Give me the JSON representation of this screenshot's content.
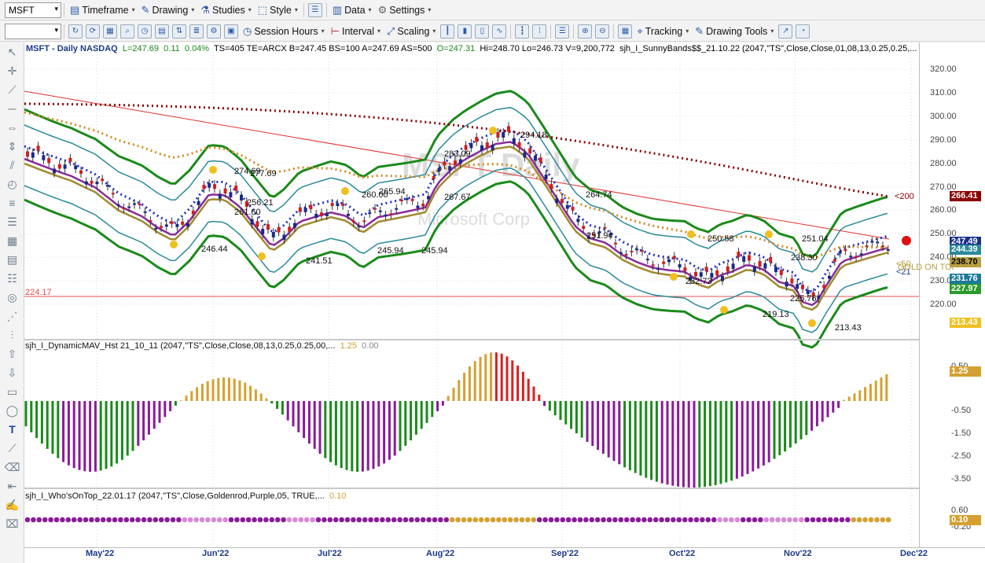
{
  "toolbar1": {
    "symbol": "MSFT",
    "timeframe": "Timeframe",
    "drawing": "Drawing",
    "studies": "Studies",
    "style": "Style",
    "data": "Data",
    "settings": "Settings"
  },
  "toolbar2": {
    "session_hours": "Session Hours",
    "interval": "Interval",
    "scaling": "Scaling",
    "tracking": "Tracking",
    "drawing_tools": "Drawing Tools"
  },
  "price_info": {
    "title": "MSFT - Daily NASDAQ",
    "last": "L=247.69",
    "change": "0.11",
    "change_pct": "0.04%",
    "rest": "TS=405  TE=ARCX  B=247.45  BS=100  A=247.69  AS=500",
    "open": "O=247.31",
    "rest2": "Hi=248.70  Lo=246.73  V=9,200,772",
    "study": "sjh_I_SunnyBands$$_21.10.22 (2047,\"TS\",Close,Close,01,08,13,0.25,0.25,..."
  },
  "watermark": {
    "ticker": "MSFT  Daily",
    "name": "Microsoft Corp"
  },
  "price_axis": [
    "320.00",
    "310.00",
    "300.00",
    "290.00",
    "280.00",
    "270.00",
    "260.00",
    "250.00",
    "240.00",
    "230.00",
    "220.00"
  ],
  "price_badges": [
    {
      "value": "266.41",
      "color": "#8b0000",
      "fg": "#ffffff"
    },
    {
      "value": "247.49",
      "color": "#1a2f8a",
      "fg": "#ffffff"
    },
    {
      "value": "244.39",
      "color": "#2a8a9a",
      "fg": "#ffffff"
    },
    {
      "value": "238.70",
      "color": "#b8a040",
      "fg": "#000000"
    },
    {
      "value": "231.76",
      "color": "#1a7a9a",
      "fg": "#ffffff"
    },
    {
      "value": "227.97",
      "color": "#2a9a2a",
      "fg": "#ffffff"
    },
    {
      "value": "213.43",
      "color": "#f0c020",
      "fg": "#ffffff"
    }
  ],
  "hline_label": "224.17",
  "ma_label_200": "<200",
  "ma_label_50": "<50",
  "ma_label_21": "<21",
  "gold_label": "GOLD ON TOP",
  "annotations": [
    {
      "text": "274.69"
    },
    {
      "text": "277.69"
    },
    {
      "text": "261.60"
    },
    {
      "text": "256.21"
    },
    {
      "text": "246.44"
    },
    {
      "text": "241.51"
    },
    {
      "text": "260.00"
    },
    {
      "text": "265.94"
    },
    {
      "text": "245.94"
    },
    {
      "text": "245.94"
    },
    {
      "text": "283.09"
    },
    {
      "text": "267.67"
    },
    {
      "text": "294.18"
    },
    {
      "text": "264.74"
    },
    {
      "text": "251.94"
    },
    {
      "text": "250.58"
    },
    {
      "text": "232.73"
    },
    {
      "text": "238.30"
    },
    {
      "text": "251.04"
    },
    {
      "text": "219.13"
    },
    {
      "text": "225.76"
    },
    {
      "text": "213.43"
    }
  ],
  "sub1": {
    "label": "sjh_I_DynamicMAV_Hst 21_10_11 (2047,\"TS\",Close,Close,08,13,0.25,0.25,00,...",
    "v1": "1.25",
    "v2": "0.00",
    "axis": [
      "0.50",
      "-0.50",
      "-1.50",
      "-2.50",
      "-3.50"
    ],
    "badge": "1.25"
  },
  "sub2": {
    "label": "sjh_I_Who'sOnTop_22.01.17 (2047,\"TS\",Close,Goldenrod,Purple,05, TRUE,...",
    "v1": "0.10",
    "axis": [
      "0.60",
      "-0.20"
    ],
    "badge": "0.10"
  },
  "x_axis": [
    "May'22",
    "Jun'22",
    "Jul'22",
    "Aug'22",
    "Sep'22",
    "Oct'22",
    "Nov'22",
    "Dec'22"
  ]
}
